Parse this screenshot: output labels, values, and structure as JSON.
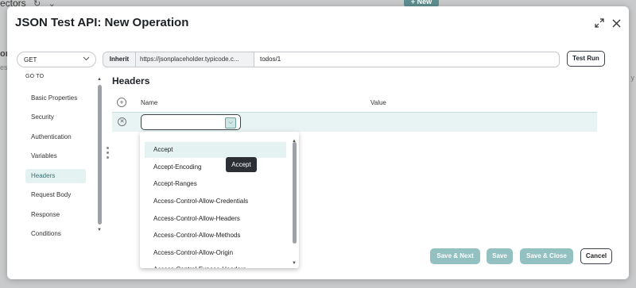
{
  "background": {
    "tab_label": "ectors",
    "tab_icons": [
      "refresh-icon",
      "chevron-down-icon"
    ],
    "new_button": "+ New",
    "left_fragment": "on",
    "left_fragment2": "es",
    "right_fragment": "y"
  },
  "dialog": {
    "title": "JSON Test API: New Operation",
    "expand_icon": "expand-icon",
    "close_icon": "close-icon"
  },
  "request": {
    "method": "GET",
    "inherit_label": "Inherit",
    "base_url": "https://jsonplaceholder.typicode.c...",
    "path": "todos/1",
    "test_run_label": "Test Run"
  },
  "nav": {
    "heading": "GO TO",
    "items": [
      {
        "label": "Basic Properties"
      },
      {
        "label": "Security"
      },
      {
        "label": "Authentication"
      },
      {
        "label": "Variables"
      },
      {
        "label": "Headers",
        "active": true
      },
      {
        "label": "Request Body"
      },
      {
        "label": "Response"
      },
      {
        "label": "Conditions"
      }
    ]
  },
  "headers_section": {
    "title": "Headers",
    "columns": {
      "name": "Name",
      "value": "Value"
    },
    "row": {
      "name_value": "",
      "value": ""
    }
  },
  "dropdown": {
    "options": [
      "Accept",
      "Accept-Encoding",
      "Accept-Ranges",
      "Access-Control-Allow-Credentials",
      "Access-Control-Allow-Headers",
      "Access-Control-Allow-Methods",
      "Access-Control-Allow-Origin",
      "Access-Control-Expose-Headers"
    ],
    "highlighted_index": 0,
    "tooltip": "Accept"
  },
  "footer": {
    "save_next": "Save & Next",
    "save": "Save",
    "save_close": "Save & Close",
    "cancel": "Cancel"
  },
  "colors": {
    "accent": "#93c1c2",
    "highlight": "#e4f3f2",
    "active_text": "#3a6f72"
  }
}
